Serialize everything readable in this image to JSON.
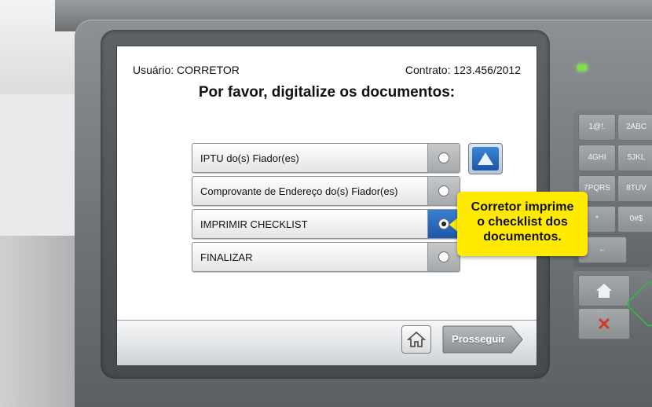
{
  "header": {
    "user_label": "Usuário: CORRETOR",
    "contract_label": "Contrato: 123.456/2012"
  },
  "title": "Por favor, digitalize os documentos:",
  "options": [
    {
      "label": "IPTU do(s) Fiador(es)",
      "selected": false
    },
    {
      "label": "Comprovante de Endereço do(s) Fiador(es)",
      "selected": false
    },
    {
      "label": "IMPRIMIR CHECKLIST",
      "selected": true
    },
    {
      "label": "FINALIZAR",
      "selected": false
    }
  ],
  "bottom_bar": {
    "home_icon": "home-icon",
    "next_label": "Prosseguir"
  },
  "callout": {
    "line1": "Corretor imprime",
    "line2": "o checklist dos",
    "line3": "documentos."
  },
  "keypad": {
    "keys": [
      "1@!.",
      "2ABC",
      "4GHI",
      "5JKL",
      "7PQRS",
      "8TUV",
      "*",
      "0#$",
      "←"
    ]
  },
  "colors": {
    "accent_blue": "#1d56a8",
    "callout_yellow": "#ffea00",
    "led_green": "#7ee04a"
  }
}
